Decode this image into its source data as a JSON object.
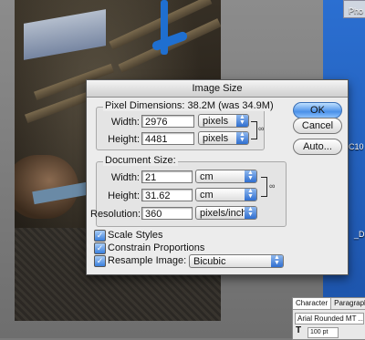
{
  "desktop": {
    "labels": [
      "Pho",
      "C10",
      "_DS"
    ]
  },
  "dialog": {
    "title": "Image Size",
    "pixel_dimensions": {
      "label": "Pixel Dimensions:",
      "summary": "38.2M (was 34.9M)",
      "width_label": "Width:",
      "width_value": "2976",
      "width_unit": "pixels",
      "height_label": "Height:",
      "height_value": "4481",
      "height_unit": "pixels"
    },
    "document_size": {
      "label": "Document Size:",
      "width_label": "Width:",
      "width_value": "21",
      "width_unit": "cm",
      "height_label": "Height:",
      "height_value": "31.62",
      "height_unit": "cm",
      "resolution_label": "Resolution:",
      "resolution_value": "360",
      "resolution_unit": "pixels/inch"
    },
    "options": {
      "scale_styles": "Scale Styles",
      "constrain_proportions": "Constrain Proportions",
      "resample_image": "Resample Image:",
      "resample_method": "Bicubic"
    },
    "buttons": {
      "ok": "OK",
      "cancel": "Cancel",
      "auto": "Auto..."
    }
  },
  "character_palette": {
    "tabs": [
      "Character",
      "Paragraph"
    ],
    "font": "Arial Rounded MT ...",
    "size": "100 pt"
  },
  "colors": {
    "accent": "#4a90e8",
    "desktop_blue": "#2b6fd1"
  }
}
